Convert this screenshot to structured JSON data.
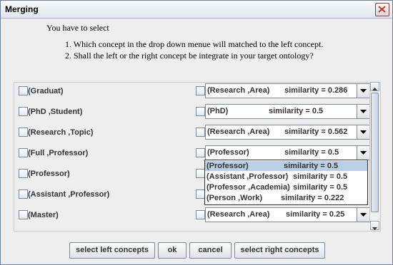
{
  "window": {
    "title": "Merging"
  },
  "intro": "You have to select",
  "instructions": [
    "1.  Which concept in the drop down menue will matched to the left concept.",
    "2.  Shall the left or the right concept be integrate in your target ontology?"
  ],
  "rows": [
    {
      "left": "(Graduat)",
      "right": "(Research ,Area)",
      "similarity": "similarity = 0.286"
    },
    {
      "left": "(PhD ,Student)",
      "right": "(PhD)",
      "similarity": "similarity = 0.5"
    },
    {
      "left": "(Research ,Topic)",
      "right": "(Research ,Area)",
      "similarity": "similarity = 0.562"
    },
    {
      "left": "(Full ,Professor)",
      "right": "(Professor)",
      "similarity": "similarity = 0.5"
    },
    {
      "left": "(Professor)"
    },
    {
      "left": "(Assistant ,Professor)"
    },
    {
      "left": "(Master)",
      "right": "(Research ,Area)",
      "similarity": "similarity = 0.25"
    }
  ],
  "dropdown_options": [
    {
      "label": "(Professor)",
      "similarity": "similarity = 0.5",
      "selected": true
    },
    {
      "label": "(Assistant ,Professor)",
      "similarity": "similarity = 0.5"
    },
    {
      "label": "(Professor ,Academia)",
      "similarity": "similarity = 0.5"
    },
    {
      "label": "(Person ,Work)",
      "similarity": "similarity = 0.222"
    }
  ],
  "buttons": {
    "select_left": "select left concepts",
    "ok": "ok",
    "cancel": "cancel",
    "select_right": "select right concepts"
  },
  "colors": {
    "selection": "#b8cfe5",
    "close_x": "#c0392b"
  }
}
